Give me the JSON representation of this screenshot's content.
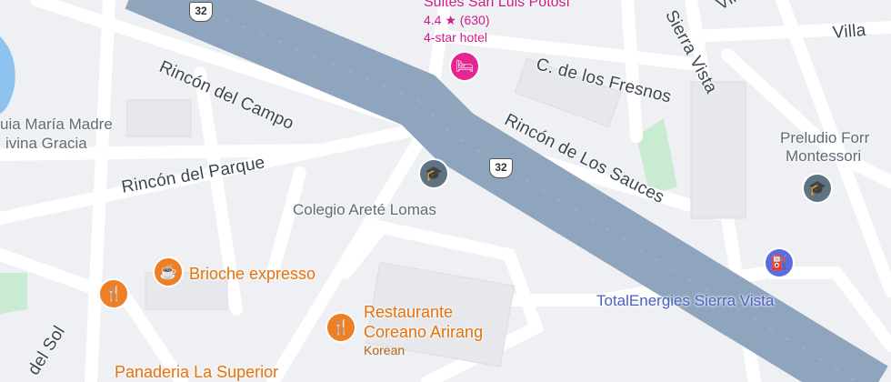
{
  "streets": {
    "rincon_del_campo": "Rincón del Campo",
    "rincon_del_parque": "Rincón del Parque",
    "rincon_de_los_sauces": "Rincón de Los Sauces",
    "c_de_los_fresnos": "C. de los Fresnos",
    "sierra_vista": "Sierra Vista",
    "del_sol": "del Sol",
    "villa": "Villa",
    "vill": "Vill"
  },
  "highway": {
    "route_number": "32"
  },
  "pois": {
    "hotel": {
      "name": "Suites San Luis Potosí",
      "rating": "4.4 ★ (630)",
      "category": "4-star hotel",
      "icon": "hotel-bed-icon",
      "color": "#e52592"
    },
    "colegio_arete": {
      "name": "Colegio Areté Lomas",
      "icon": "school-cap-icon",
      "color": "#5f7483"
    },
    "preludio": {
      "name_line1": "Preludio Forr",
      "name_line2": "Montessori",
      "icon": "school-cap-icon",
      "color": "#5f7483"
    },
    "guia_maria": {
      "name_line1": "uia María Madre",
      "name_line2": "ivina Gracia"
    },
    "brioche": {
      "name": "Brioche expresso",
      "icon": "coffee-cup-icon",
      "color": "#ef7f25"
    },
    "restaurante": {
      "name_line1": "Restaurante",
      "name_line2": "Coreano Arirang",
      "category": "Korean",
      "icon": "fork-knife-icon",
      "color": "#ef7f25"
    },
    "panaderia": {
      "name": "Panaderia La Superior",
      "icon": "fork-knife-icon",
      "color": "#ef7f25"
    },
    "totalenergies": {
      "name": "TotalEnergies Sierra Vista",
      "icon": "gas-pump-icon",
      "color": "#5b6ee0"
    }
  },
  "colors": {
    "highway": "#8fa4bd",
    "road": "#ffffff",
    "block": "#e4e7eb",
    "park": "#c8ebd2",
    "water": "#8ec2ef",
    "street_text": "#3c4650"
  }
}
